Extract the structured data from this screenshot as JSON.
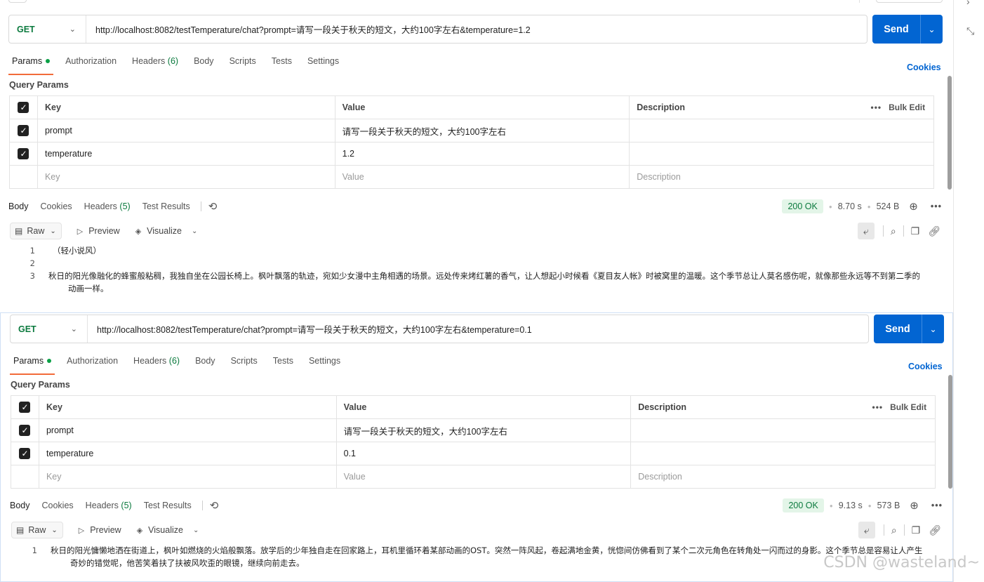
{
  "panels": [
    {
      "method": "GET",
      "url": "http://localhost:8082/testTemperature/chat?prompt=请写一段关于秋天的短文，大约100字左右&temperature=1.2",
      "send_label": "Send",
      "tabs": [
        {
          "label": "Params"
        },
        {
          "label": "Authorization"
        },
        {
          "label": "Headers",
          "count": "(6)"
        },
        {
          "label": "Body"
        },
        {
          "label": "Scripts"
        },
        {
          "label": "Tests"
        },
        {
          "label": "Settings"
        }
      ],
      "cookies_label": "Cookies",
      "query_params_title": "Query Params",
      "table": {
        "headers": {
          "key": "Key",
          "value": "Value",
          "description": "Description",
          "bulk_edit": "Bulk Edit"
        },
        "rows": [
          {
            "key": "prompt",
            "value": "请写一段关于秋天的短文，大约100字左右",
            "description": ""
          },
          {
            "key": "temperature",
            "value": "1.2",
            "description": ""
          }
        ],
        "placeholders": {
          "key": "Key",
          "value": "Value",
          "description": "Description"
        }
      },
      "response": {
        "tabs": [
          {
            "label": "Body"
          },
          {
            "label": "Cookies"
          },
          {
            "label": "Headers",
            "count": "(5)"
          },
          {
            "label": "Test Results"
          }
        ],
        "status": "200 OK",
        "time": "8.70 s",
        "size": "524 B",
        "format": "Raw",
        "preview_label": "Preview",
        "visualize_label": "Visualize",
        "lines": [
          {
            "n": "1",
            "text": "（轻小说风）"
          },
          {
            "n": "2",
            "text": ""
          },
          {
            "n": "3",
            "text": "秋日的阳光像融化的蜂蜜般粘稠，我独自坐在公园长椅上。枫叶飘落的轨迹，宛如少女漫中主角相遇的场景。远处传来烤红薯的香气，让人想起小时候看《夏目友人帐》时被窝里的温暖。这个季节总让人莫名感伤呢，就像那些永远等不到第二季的动画一样。"
          }
        ]
      }
    },
    {
      "method": "GET",
      "url": "http://localhost:8082/testTemperature/chat?prompt=请写一段关于秋天的短文，大约100字左右&temperature=0.1",
      "send_label": "Send",
      "tabs": [
        {
          "label": "Params"
        },
        {
          "label": "Authorization"
        },
        {
          "label": "Headers",
          "count": "(6)"
        },
        {
          "label": "Body"
        },
        {
          "label": "Scripts"
        },
        {
          "label": "Tests"
        },
        {
          "label": "Settings"
        }
      ],
      "cookies_label": "Cookies",
      "query_params_title": "Query Params",
      "table": {
        "headers": {
          "key": "Key",
          "value": "Value",
          "description": "Description",
          "bulk_edit": "Bulk Edit"
        },
        "rows": [
          {
            "key": "prompt",
            "value": "请写一段关于秋天的短文，大约100字左右",
            "description": ""
          },
          {
            "key": "temperature",
            "value": "0.1",
            "description": ""
          }
        ],
        "placeholders": {
          "key": "Key",
          "value": "Value",
          "description": "Description"
        }
      },
      "response": {
        "tabs": [
          {
            "label": "Body"
          },
          {
            "label": "Cookies"
          },
          {
            "label": "Headers",
            "count": "(5)"
          },
          {
            "label": "Test Results"
          }
        ],
        "status": "200 OK",
        "time": "9.13 s",
        "size": "573 B",
        "format": "Raw",
        "preview_label": "Preview",
        "visualize_label": "Visualize",
        "lines": [
          {
            "n": "1",
            "text": "秋日的阳光慵懒地洒在街道上，枫叶如燃烧的火焰般飘落。放学后的少年独自走在回家路上，耳机里循环着某部动画的OST。突然一阵风起，卷起满地金黄，恍惚间仿佛看到了某个二次元角色在转角处一闪而过的身影。这个季节总是容易让人产生奇妙的错觉呢，他苦笑着扶了扶被风吹歪的眼镜，继续向前走去。"
          }
        ]
      }
    }
  ],
  "colors": {
    "send_button": "#0265d2",
    "method_get": "#0b7a3e",
    "active_tab_underline": "#f26b3a",
    "status_ok_bg": "#e3f5e8",
    "link": "#0265d2"
  },
  "icons": [
    "chevron-down-icon",
    "checkbox-checked-icon",
    "more-icon",
    "history-icon",
    "globe-icon",
    "raw-doc-icon",
    "play-icon",
    "visualize-icon",
    "wrap-lines-icon",
    "search-icon",
    "copy-icon",
    "link-icon",
    "collapse-icon"
  ],
  "watermark": "CSDN @wasteland~"
}
